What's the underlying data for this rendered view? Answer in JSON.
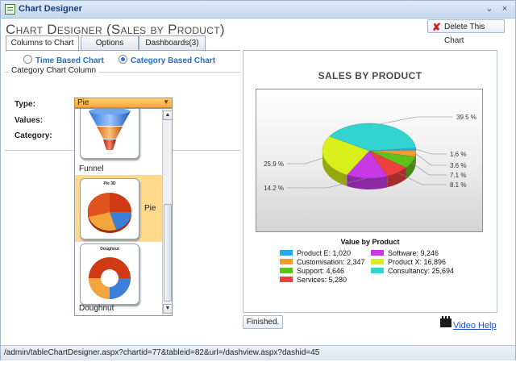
{
  "window": {
    "title": "Chart Designer",
    "minimize_glyph": "⌄",
    "close_glyph": "×",
    "status_url": "/admin/tableChartDesigner.aspx?chartid=77&tableid=82&url=/dashview.aspx?dashid=45"
  },
  "header": {
    "title": "Chart Designer (Sales by Product)",
    "delete_label": "Delete This Chart"
  },
  "tabs": [
    {
      "label": "Columns to Chart",
      "active": true
    },
    {
      "label": "Options",
      "active": false
    },
    {
      "label": "Dashboards(3)",
      "active": false
    }
  ],
  "chart_mode": {
    "time_based_label": "Time Based Chart",
    "category_based_label": "Category Based Chart",
    "selected": "category"
  },
  "form": {
    "legend": "Category Chart Column",
    "type_label": "Type:",
    "values_label": "Values:",
    "category_label": "Category:",
    "type_value": "Pie"
  },
  "chart_types": [
    {
      "label": "Funnel",
      "thumb_title": "",
      "selected": false
    },
    {
      "label": "Pie",
      "thumb_title": "Pie 3D",
      "selected": true
    },
    {
      "label": "Doughnut",
      "thumb_title": "Doughnut",
      "selected": false
    }
  ],
  "buttons": {
    "finished": "Finished.",
    "video_help": "Video Help"
  },
  "colors": {
    "accent": "#1f6fd1",
    "select_bg": "#f7a83b",
    "highlight": "#ffd98c"
  },
  "chart_data": {
    "type": "pie",
    "title": "Sales by Product",
    "legend_title": "Value by Product",
    "legend_position": "bottom",
    "slices": [
      {
        "name": "Product E",
        "value": 1020,
        "label": "Product E: 1,020",
        "percent_label": "1.6 %",
        "color": "#27a9e1"
      },
      {
        "name": "Customisation",
        "value": 2347,
        "label": "Customisation: 2,347",
        "percent_label": "3.6 %",
        "color": "#f79a2e"
      },
      {
        "name": "Support",
        "value": 4646,
        "label": "Support: 4,646",
        "percent_label": "7.1 %",
        "color": "#5ec21b"
      },
      {
        "name": "Services",
        "value": 5280,
        "label": "Services: 5,280",
        "percent_label": "8.1 %",
        "color": "#ef4040"
      },
      {
        "name": "Software",
        "value": 9246,
        "label": "Software: 9,246",
        "percent_label": "14.2 %",
        "color": "#c839e6"
      },
      {
        "name": "Product X",
        "value": 16896,
        "label": "Product X: 16,896",
        "percent_label": "25.9 %",
        "color": "#d8ef1c"
      },
      {
        "name": "Consultancy",
        "value": 25694,
        "label": "Consultancy: 25,694",
        "percent_label": "39.5 %",
        "color": "#33d3d0"
      }
    ]
  }
}
